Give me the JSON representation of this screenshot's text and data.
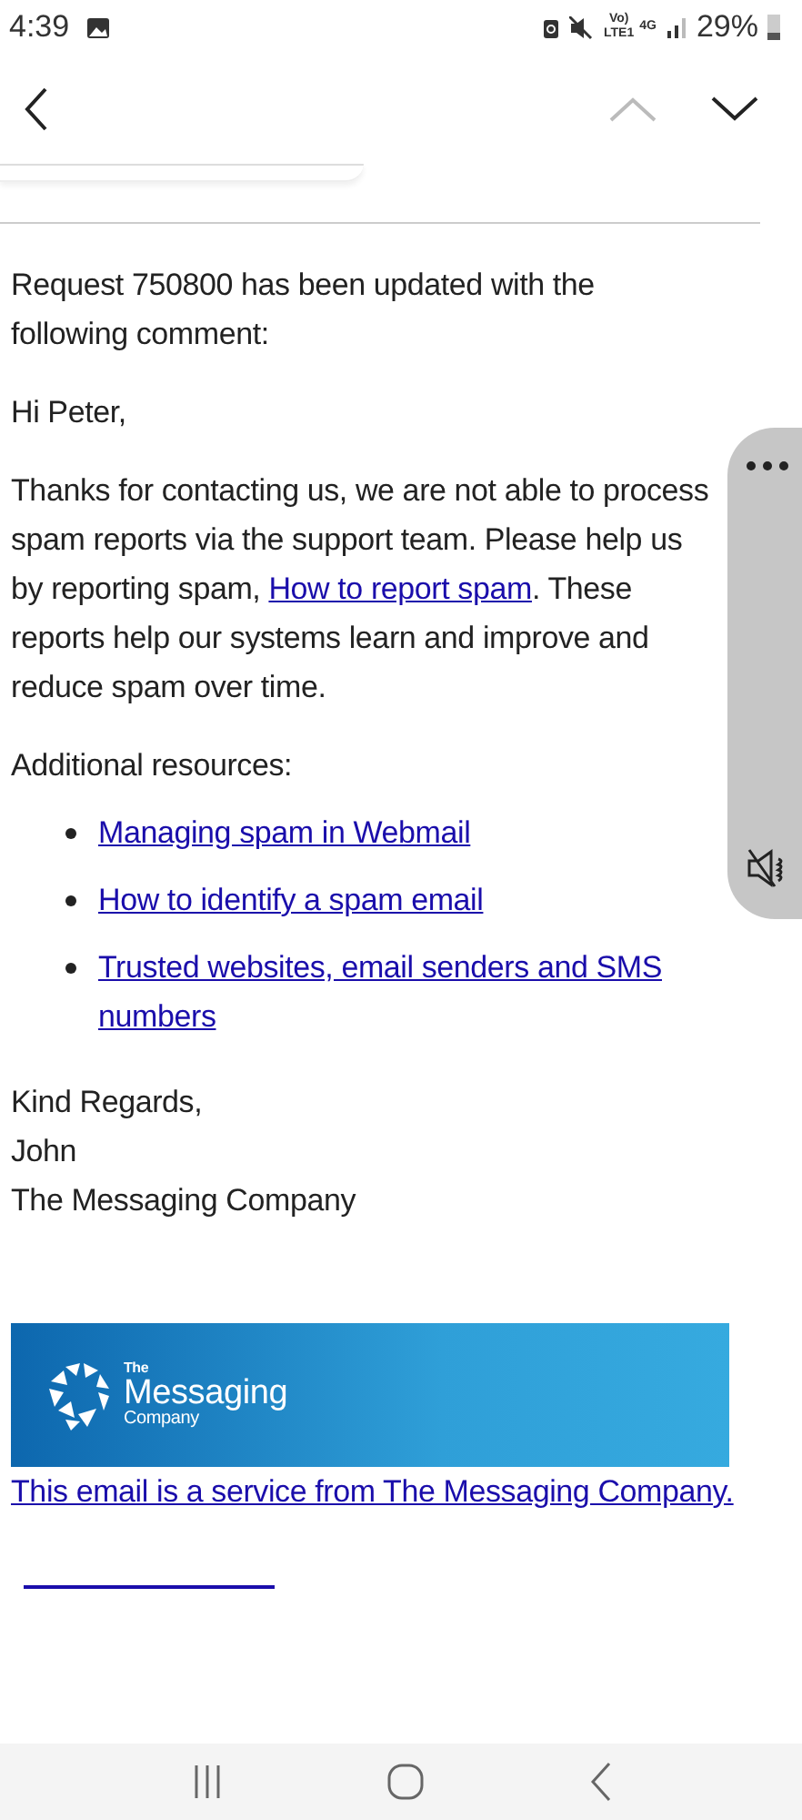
{
  "status_bar": {
    "time": "4:39",
    "network": [
      "Vo)",
      "LTE1",
      "4G"
    ],
    "battery": "29%"
  },
  "toolbar": {
    "previous_disabled": true,
    "next_disabled": false
  },
  "email": {
    "intro": "Request 750800 has been updated with the following comment:",
    "greeting": "Hi Peter,",
    "body": {
      "before": "Thanks for contacting us, we are not able to process spam reports via the support team. Please help us by reporting spam, ",
      "link": "How to report spam",
      "after": ". These reports help our systems learn and improve and reduce spam over time."
    },
    "resources_heading": "Additional resources:",
    "resources": [
      {
        "label": "Managing spam in Webmail"
      },
      {
        "label": "How to identify a spam email"
      },
      {
        "label": "Trusted websites, email senders and SMS numbers"
      }
    ],
    "signoff": [
      "Kind Regards,",
      "John",
      "The Messaging Company"
    ],
    "banner": {
      "logo": [
        "The",
        "Messaging",
        "Company"
      ]
    },
    "footer_link": "This email is a service from The Messaging Company."
  }
}
